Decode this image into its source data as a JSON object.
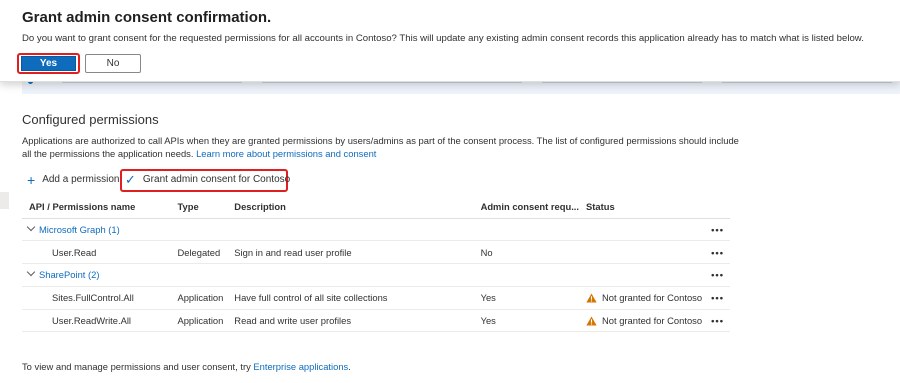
{
  "dialog": {
    "title": "Grant admin consent confirmation.",
    "message": "Do you want to grant consent for the requested permissions for all accounts in Contoso? This will update any existing admin consent records this application already has to match what is listed below.",
    "yes_label": "Yes",
    "no_label": "No"
  },
  "section": {
    "title": "Configured permissions",
    "description": "Applications are authorized to call APIs when they are granted permissions by users/admins as part of the consent process. The list of configured permissions should include all the permissions the application needs.",
    "learn_more": "Learn more about permissions and consent"
  },
  "toolbar": {
    "add_permission": "Add a permission",
    "grant_consent": "Grant admin consent for Contoso"
  },
  "table": {
    "headers": [
      "API / Permissions name",
      "Type",
      "Description",
      "Admin consent requ...",
      "Status"
    ],
    "groups": [
      {
        "name": "Microsoft Graph (1)",
        "rows": [
          {
            "name": "User.Read",
            "type": "Delegated",
            "description": "Sign in and read user profile",
            "admin_consent": "No",
            "status": ""
          }
        ]
      },
      {
        "name": "SharePoint (2)",
        "rows": [
          {
            "name": "Sites.FullControl.All",
            "type": "Application",
            "description": "Have full control of all site collections",
            "admin_consent": "Yes",
            "status": "Not granted for Contoso"
          },
          {
            "name": "User.ReadWrite.All",
            "type": "Application",
            "description": "Read and write user profiles",
            "admin_consent": "Yes",
            "status": "Not granted for Contoso"
          }
        ]
      }
    ],
    "more_label": "•••"
  },
  "footer": {
    "text": "To view and manage permissions and user consent, try",
    "link": "Enterprise applications",
    "suffix": "."
  },
  "colors": {
    "accent": "#0f6cbd",
    "highlight": "#e02020",
    "warning": "#d47500"
  },
  "icons": [
    "plus-icon",
    "checkmark-icon",
    "chevron-down-icon",
    "warning-icon",
    "more-icon"
  ]
}
